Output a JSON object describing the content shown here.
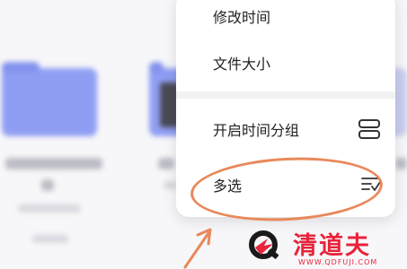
{
  "menu": {
    "items": [
      {
        "label": "修改时间"
      },
      {
        "label": "文件大小"
      },
      {
        "label": "开启时间分组",
        "icon": "group-by-time-icon"
      },
      {
        "label": "多选",
        "icon": "multi-select-icon"
      }
    ]
  },
  "watermark": {
    "brand": "清道夫",
    "url": "WWW.QDFUJI.COM"
  },
  "colors": {
    "highlight": "#e9885a",
    "folder": "#8f9ef3",
    "watermark": "#e8233a"
  }
}
